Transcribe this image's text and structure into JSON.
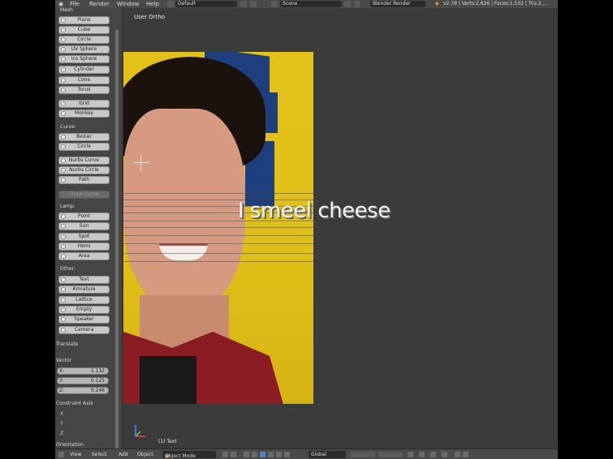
{
  "topbar": {
    "menus": [
      "File",
      "Render",
      "Window",
      "Help"
    ],
    "layout": "Default",
    "scene": "Scene",
    "engine": "Blender Render",
    "stats": "v2.79 | Verts:2,626 | Faces:1,532 | Tris:2,..."
  },
  "viewport": {
    "label": "User Ortho",
    "text3d": "I smeel cheese",
    "object_name": "(1) Text"
  },
  "shelf": {
    "mesh_header": "Mesh",
    "mesh": [
      "Plane",
      "Cube",
      "Circle",
      "UV Sphere",
      "Ico Sphere",
      "Cylinder",
      "Cone",
      "Torus"
    ],
    "mesh2": [
      "Grid",
      "Monkey"
    ],
    "curve_header": "Curve:",
    "curve": [
      "Bezier",
      "Circle"
    ],
    "curve2": [
      "Nurbs Curve",
      "Nurbs Circle",
      "Path"
    ],
    "draw_curve": "Draw Curve",
    "lamp_header": "Lamp:",
    "lamp": [
      "Point",
      "Sun",
      "Spot",
      "Hemi",
      "Area"
    ],
    "other_header": "Other:",
    "other": [
      "Text",
      "Armature",
      "Lattice",
      "Empty",
      "Speaker",
      "Camera"
    ],
    "translate": "Translate",
    "vector": "Vector",
    "x": "X:",
    "x_val": "1.132",
    "y": "Y:",
    "y_val": "0.125",
    "z": "Z:",
    "z_val": "0.246",
    "constraint": "Constraint Axis",
    "axis_x": "X",
    "axis_y": "Y",
    "axis_z": "Z",
    "orientation": "Orientation"
  },
  "bottombar": {
    "view": "View",
    "select": "Select",
    "add": "Add",
    "object": "Object",
    "mode": "Object Mode",
    "orientation": "Global"
  }
}
